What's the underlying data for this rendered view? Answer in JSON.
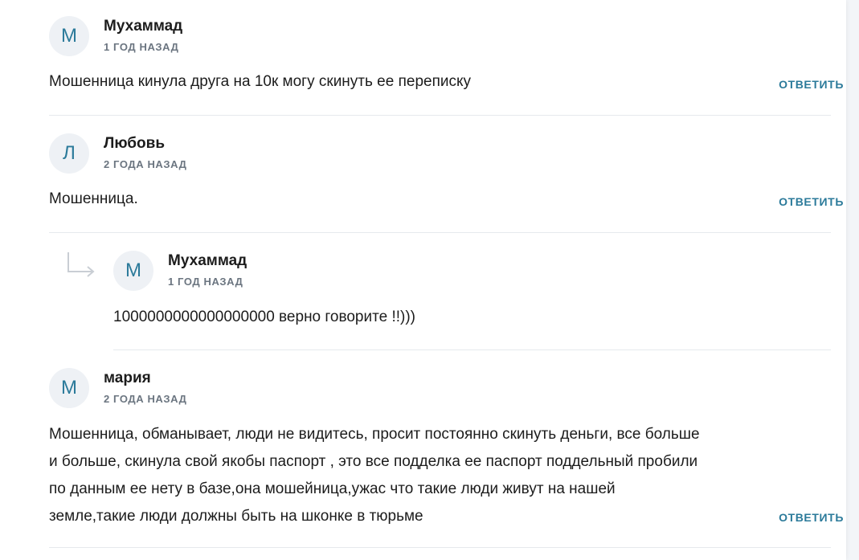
{
  "comments": [
    {
      "avatar_letter": "М",
      "author": "Мухаммад",
      "time": "1 ГОД НАЗАД",
      "text_lines": [
        "Мошенница кинула друга на 10к могу скинуть ее переписку"
      ],
      "reply_label": "ОТВЕТИТЬ"
    },
    {
      "avatar_letter": "Л",
      "author": "Любовь",
      "time": "2 ГОДА НАЗАД",
      "text_lines": [
        "Мошенница."
      ],
      "reply_label": "ОТВЕТИТЬ"
    },
    {
      "avatar_letter": "М",
      "author": "Мухаммад",
      "time": "1 ГОД НАЗАД",
      "text_lines": [
        "1000000000000000000 верно говорите !!)))"
      ]
    },
    {
      "avatar_letter": "М",
      "author": "мария",
      "time": "2 ГОДА НАЗАД",
      "text_lines": [
        "Мошенница, обманывает, люди не видитесь, просит постоянно скинуть деньги, все больше",
        "и больше, скинула свой якобы паспорт , это все подделка ее паспорт поддельный пробили",
        "по данным ее нету в базе,она мошейница,ужас что такие люди живут на нашей",
        "земле,такие люди должны быть на шконке в тюрьме"
      ],
      "reply_label": "ОТВЕТИТЬ"
    }
  ]
}
